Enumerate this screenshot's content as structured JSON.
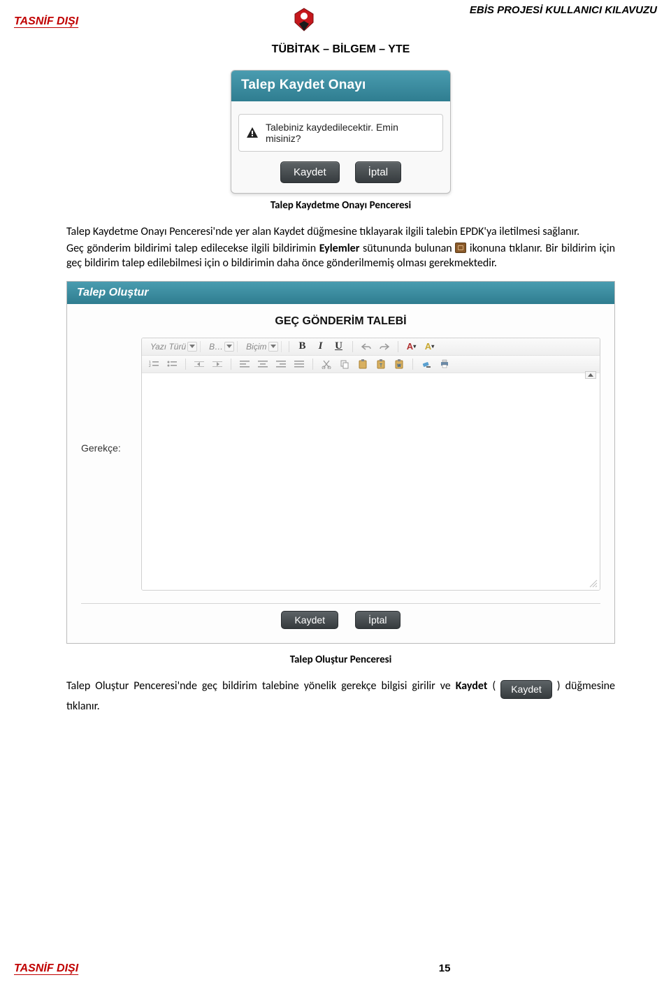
{
  "header": {
    "classification": "TASNİF DIŞI",
    "doc_title": "EBİS PROJESİ KULLANICI KILAVUZU",
    "org": "TÜBİTAK – BİLGEM – YTE"
  },
  "dialog": {
    "title": "Talep Kaydet Onayı",
    "message": "Talebiniz kaydedilecektir. Emin misiniz?",
    "save_label": "Kaydet",
    "cancel_label": "İptal",
    "caption": "Talep Kaydetme Onayı Penceresi"
  },
  "para1": {
    "t1": "Talep Kaydetme Onayı Penceresi'nde yer alan Kaydet düğmesine tıklayarak ilgili talebin EPDK'ya iletilmesi sağlanır."
  },
  "para2": {
    "pre": "Geç gönderim bildirimi talep edilecekse ilgili bildirimin ",
    "bold": "Eylemler",
    "mid": " sütununda bulunan ",
    "post": " ikonuna tıklanır. Bir bildirim için geç bildirim talep edilebilmesi için o bildirimin daha önce gönderilmemiş olması gerekmektedir."
  },
  "panel": {
    "title": "Talep Oluştur",
    "form_title": "GEÇ GÖNDERİM TALEBİ",
    "label": "Gerekçe:",
    "toolbar": {
      "font_family": "Yazı Türü",
      "font_size": "B…",
      "style": "Biçim",
      "bold": "B",
      "italic": "I",
      "underline": "U",
      "colorA": "A",
      "colorB": "A"
    },
    "save_label": "Kaydet",
    "cancel_label": "İptal",
    "caption": "Talep Oluştur Penceresi"
  },
  "para3": {
    "pre": "Talep Oluştur Penceresi'nde geç bildirim talebine yönelik gerekçe bilgisi girilir ve ",
    "bold": "Kaydet",
    "post1": " ( ",
    "btn": "Kaydet",
    "post2": " ) düğmesine tıklanır."
  },
  "footer": {
    "classification": "TASNİF DIŞI",
    "page": "15"
  }
}
